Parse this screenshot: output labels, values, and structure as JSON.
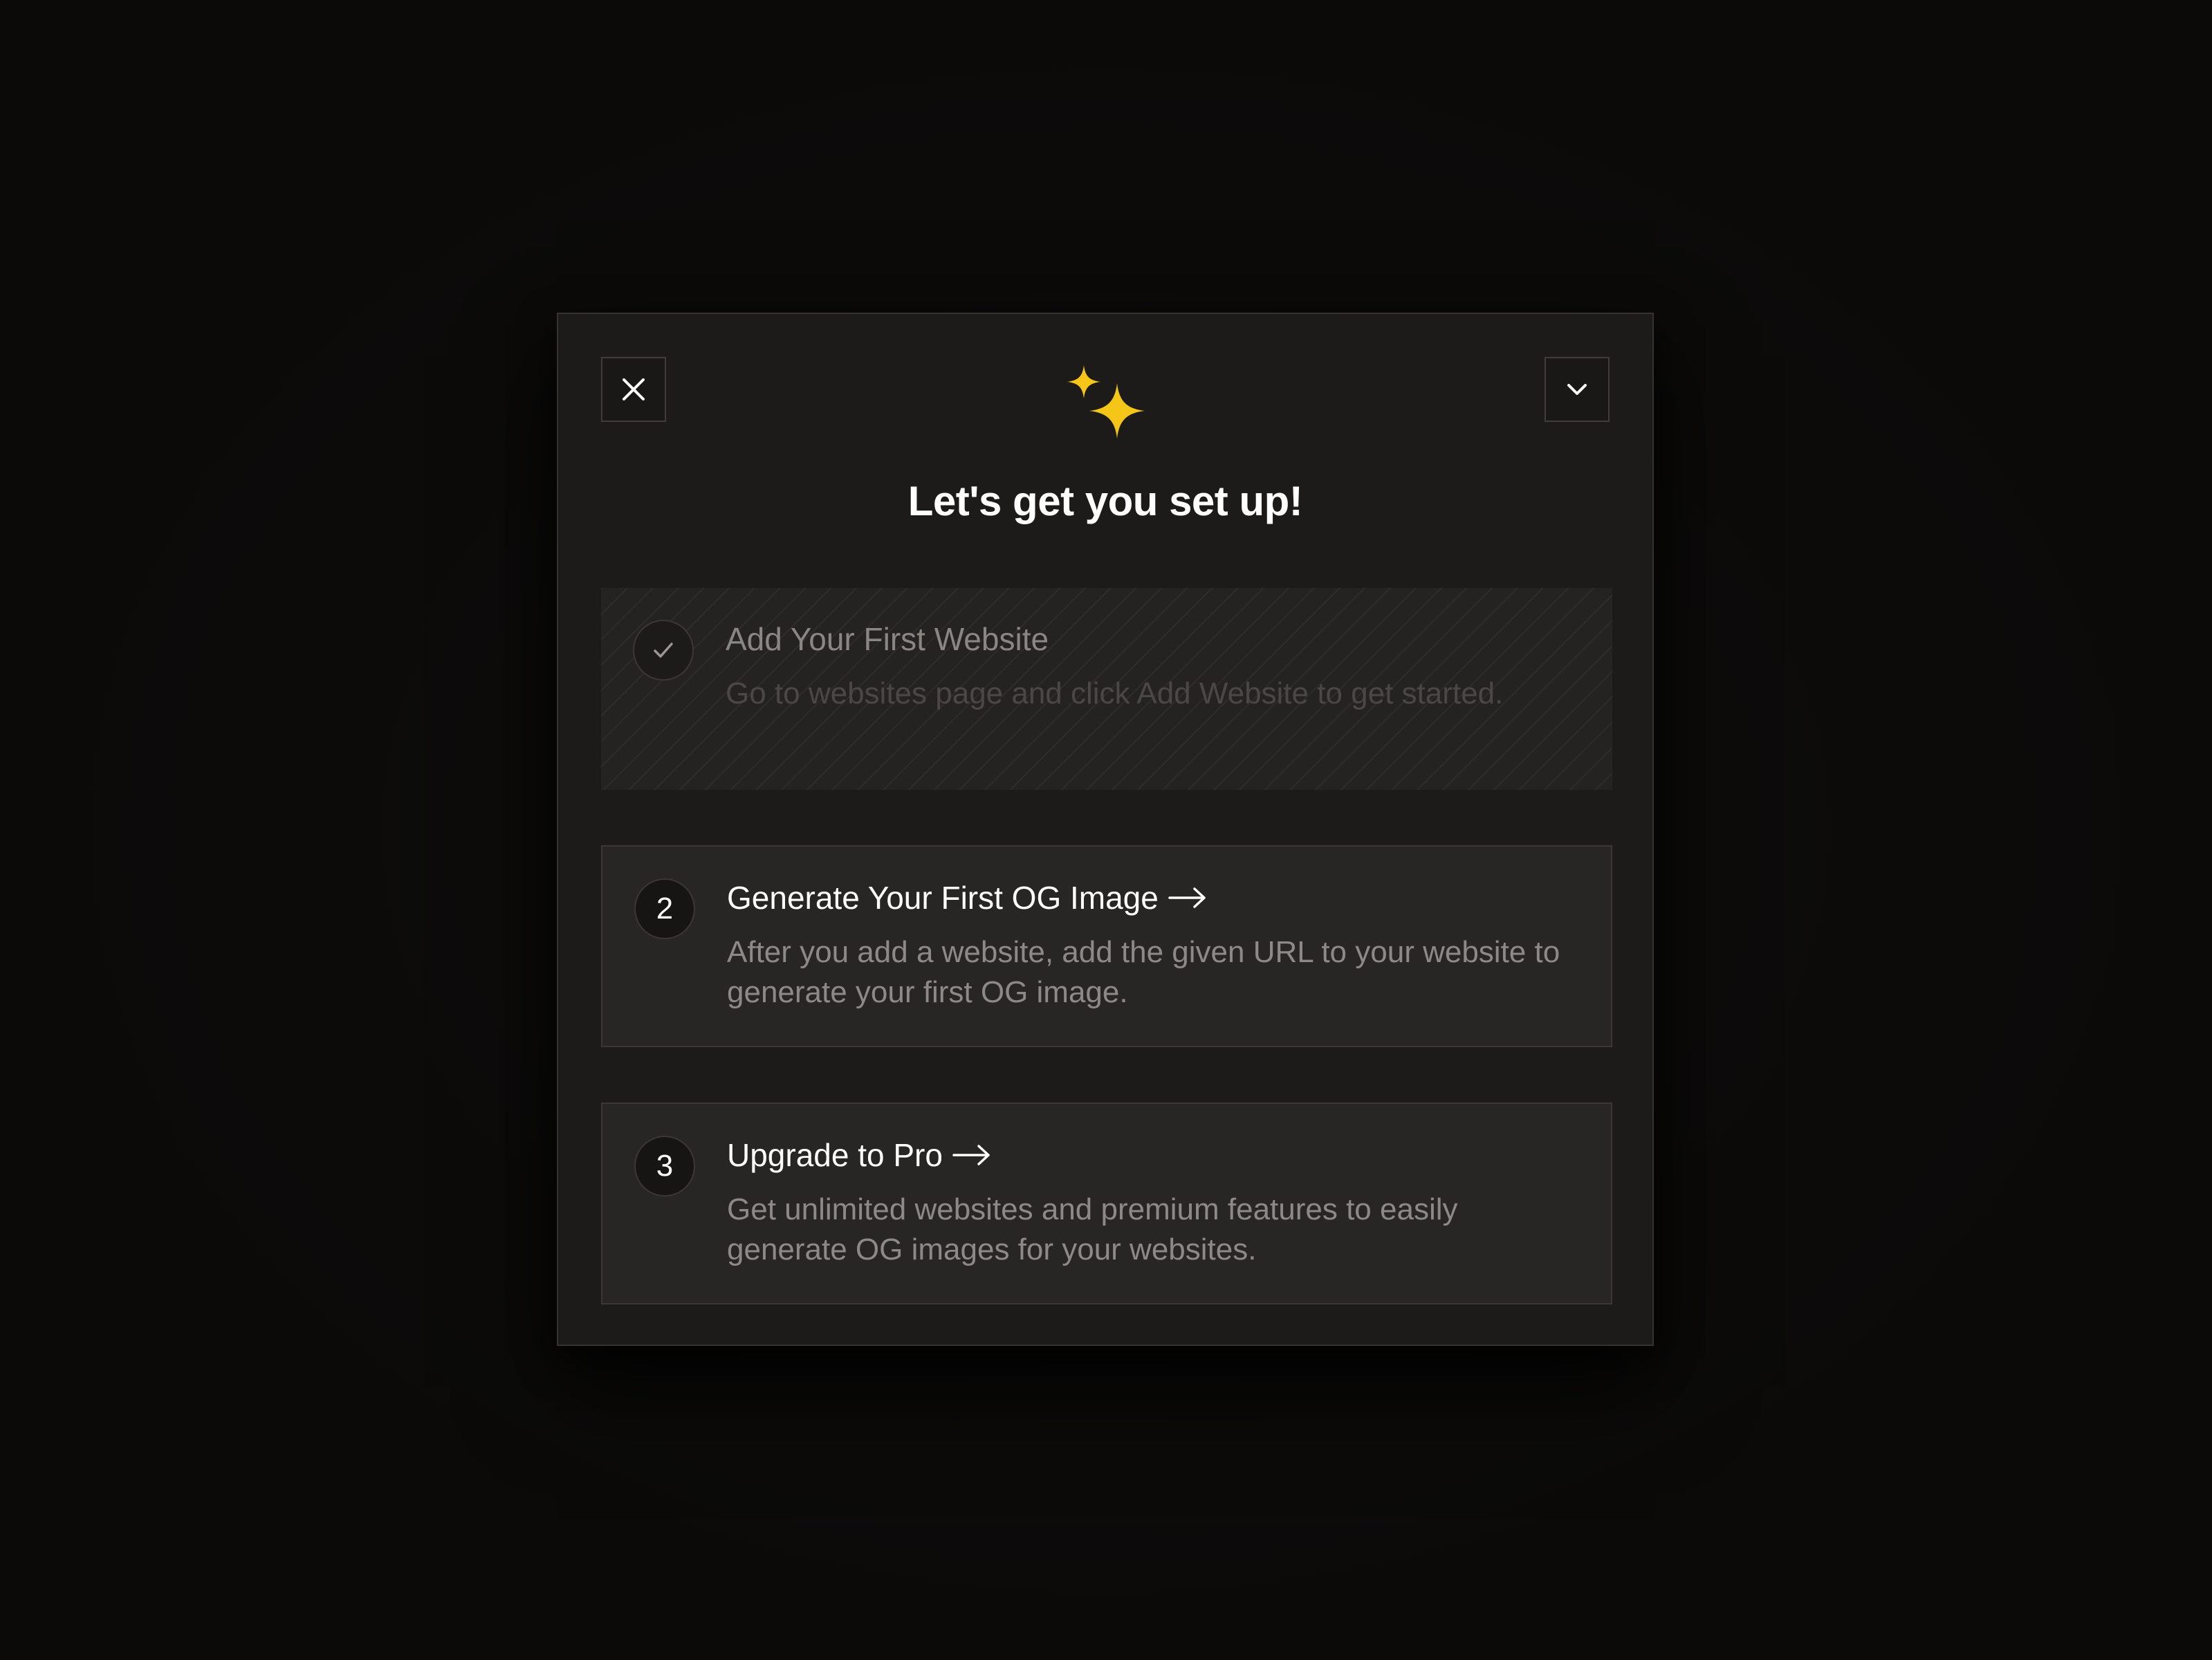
{
  "modal": {
    "title": "Let's get you set up!",
    "sparkle_icon": "sparkles-icon",
    "sparkle_color": "#f5c518",
    "close_icon": "close-icon",
    "collapse_icon": "chevron-down-icon"
  },
  "steps": [
    {
      "status": "completed",
      "marker": "",
      "marker_icon": "check-icon",
      "title": "Add Your First Website",
      "description": "Go to websites page and click Add Website to get started."
    },
    {
      "status": "pending",
      "marker": "2",
      "title": "Generate Your First OG Image",
      "title_icon": "arrow-right-icon",
      "description": "After you add a website, add the given URL to your website to generate your first OG image."
    },
    {
      "status": "pending",
      "marker": "3",
      "title": "Upgrade to Pro",
      "title_icon": "arrow-right-icon",
      "description": "Get unlimited websites and premium features to easily generate OG images for your websites."
    }
  ]
}
